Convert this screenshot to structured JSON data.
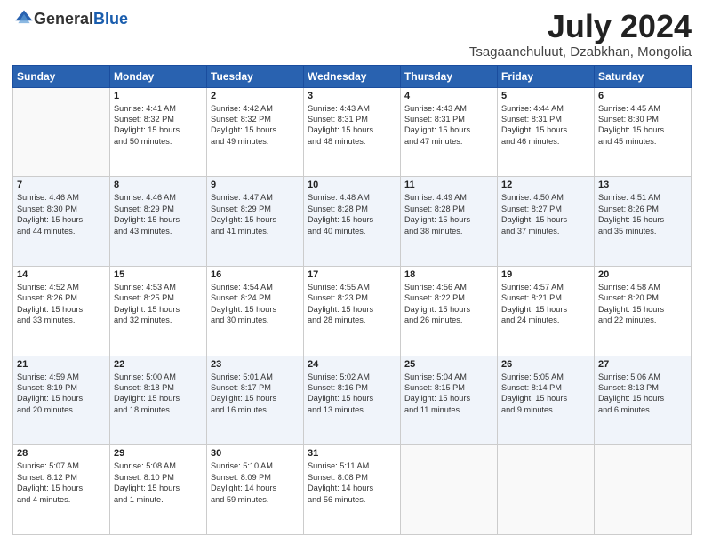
{
  "logo": {
    "general": "General",
    "blue": "Blue"
  },
  "title": "July 2024",
  "subtitle": "Tsagaanchuluut, Dzabkhan, Mongolia",
  "weekdays": [
    "Sunday",
    "Monday",
    "Tuesday",
    "Wednesday",
    "Thursday",
    "Friday",
    "Saturday"
  ],
  "weeks": [
    [
      {
        "day": "",
        "info": ""
      },
      {
        "day": "1",
        "info": "Sunrise: 4:41 AM\nSunset: 8:32 PM\nDaylight: 15 hours\nand 50 minutes."
      },
      {
        "day": "2",
        "info": "Sunrise: 4:42 AM\nSunset: 8:32 PM\nDaylight: 15 hours\nand 49 minutes."
      },
      {
        "day": "3",
        "info": "Sunrise: 4:43 AM\nSunset: 8:31 PM\nDaylight: 15 hours\nand 48 minutes."
      },
      {
        "day": "4",
        "info": "Sunrise: 4:43 AM\nSunset: 8:31 PM\nDaylight: 15 hours\nand 47 minutes."
      },
      {
        "day": "5",
        "info": "Sunrise: 4:44 AM\nSunset: 8:31 PM\nDaylight: 15 hours\nand 46 minutes."
      },
      {
        "day": "6",
        "info": "Sunrise: 4:45 AM\nSunset: 8:30 PM\nDaylight: 15 hours\nand 45 minutes."
      }
    ],
    [
      {
        "day": "7",
        "info": "Sunrise: 4:46 AM\nSunset: 8:30 PM\nDaylight: 15 hours\nand 44 minutes."
      },
      {
        "day": "8",
        "info": "Sunrise: 4:46 AM\nSunset: 8:29 PM\nDaylight: 15 hours\nand 43 minutes."
      },
      {
        "day": "9",
        "info": "Sunrise: 4:47 AM\nSunset: 8:29 PM\nDaylight: 15 hours\nand 41 minutes."
      },
      {
        "day": "10",
        "info": "Sunrise: 4:48 AM\nSunset: 8:28 PM\nDaylight: 15 hours\nand 40 minutes."
      },
      {
        "day": "11",
        "info": "Sunrise: 4:49 AM\nSunset: 8:28 PM\nDaylight: 15 hours\nand 38 minutes."
      },
      {
        "day": "12",
        "info": "Sunrise: 4:50 AM\nSunset: 8:27 PM\nDaylight: 15 hours\nand 37 minutes."
      },
      {
        "day": "13",
        "info": "Sunrise: 4:51 AM\nSunset: 8:26 PM\nDaylight: 15 hours\nand 35 minutes."
      }
    ],
    [
      {
        "day": "14",
        "info": "Sunrise: 4:52 AM\nSunset: 8:26 PM\nDaylight: 15 hours\nand 33 minutes."
      },
      {
        "day": "15",
        "info": "Sunrise: 4:53 AM\nSunset: 8:25 PM\nDaylight: 15 hours\nand 32 minutes."
      },
      {
        "day": "16",
        "info": "Sunrise: 4:54 AM\nSunset: 8:24 PM\nDaylight: 15 hours\nand 30 minutes."
      },
      {
        "day": "17",
        "info": "Sunrise: 4:55 AM\nSunset: 8:23 PM\nDaylight: 15 hours\nand 28 minutes."
      },
      {
        "day": "18",
        "info": "Sunrise: 4:56 AM\nSunset: 8:22 PM\nDaylight: 15 hours\nand 26 minutes."
      },
      {
        "day": "19",
        "info": "Sunrise: 4:57 AM\nSunset: 8:21 PM\nDaylight: 15 hours\nand 24 minutes."
      },
      {
        "day": "20",
        "info": "Sunrise: 4:58 AM\nSunset: 8:20 PM\nDaylight: 15 hours\nand 22 minutes."
      }
    ],
    [
      {
        "day": "21",
        "info": "Sunrise: 4:59 AM\nSunset: 8:19 PM\nDaylight: 15 hours\nand 20 minutes."
      },
      {
        "day": "22",
        "info": "Sunrise: 5:00 AM\nSunset: 8:18 PM\nDaylight: 15 hours\nand 18 minutes."
      },
      {
        "day": "23",
        "info": "Sunrise: 5:01 AM\nSunset: 8:17 PM\nDaylight: 15 hours\nand 16 minutes."
      },
      {
        "day": "24",
        "info": "Sunrise: 5:02 AM\nSunset: 8:16 PM\nDaylight: 15 hours\nand 13 minutes."
      },
      {
        "day": "25",
        "info": "Sunrise: 5:04 AM\nSunset: 8:15 PM\nDaylight: 15 hours\nand 11 minutes."
      },
      {
        "day": "26",
        "info": "Sunrise: 5:05 AM\nSunset: 8:14 PM\nDaylight: 15 hours\nand 9 minutes."
      },
      {
        "day": "27",
        "info": "Sunrise: 5:06 AM\nSunset: 8:13 PM\nDaylight: 15 hours\nand 6 minutes."
      }
    ],
    [
      {
        "day": "28",
        "info": "Sunrise: 5:07 AM\nSunset: 8:12 PM\nDaylight: 15 hours\nand 4 minutes."
      },
      {
        "day": "29",
        "info": "Sunrise: 5:08 AM\nSunset: 8:10 PM\nDaylight: 15 hours\nand 1 minute."
      },
      {
        "day": "30",
        "info": "Sunrise: 5:10 AM\nSunset: 8:09 PM\nDaylight: 14 hours\nand 59 minutes."
      },
      {
        "day": "31",
        "info": "Sunrise: 5:11 AM\nSunset: 8:08 PM\nDaylight: 14 hours\nand 56 minutes."
      },
      {
        "day": "",
        "info": ""
      },
      {
        "day": "",
        "info": ""
      },
      {
        "day": "",
        "info": ""
      }
    ]
  ]
}
